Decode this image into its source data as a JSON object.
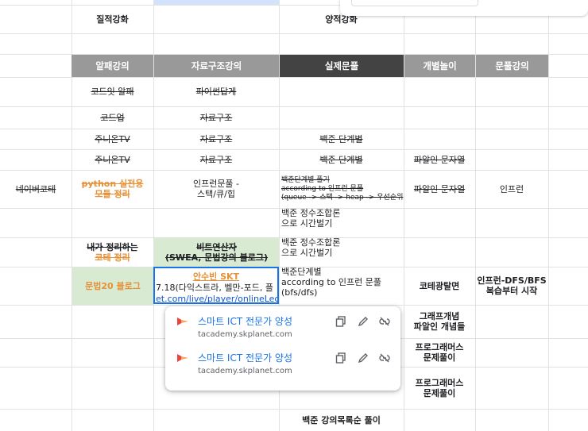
{
  "row_top": {
    "col1": "질적강화",
    "col3": "양적강화"
  },
  "headers": {
    "c1": "알패강의",
    "c2": "자료구조강의",
    "c3": "실제문풀",
    "c4": "개별놀이",
    "c5": "문풀강의"
  },
  "rows": {
    "r1_c1": "코드잇 알패",
    "r1_c2": "파이썬답게",
    "r2_c1": "코드업",
    "r2_c2": "자료구조",
    "r3_c1": "주니온TV",
    "r3_c2": "자료구조",
    "r3_c3": "백준 단계별",
    "r4_c1": "주니온TV",
    "r4_c2": "자료구조",
    "r4_c3": "백준 단계별",
    "r4_c4": "파알인 문자열",
    "r5_c0": "네이버코테",
    "r5_c1_l1": "python 실전용",
    "r5_c1_l2": "모듈 정리",
    "r5_c2_l1": "인프런문풀 -",
    "r5_c2_l2": "스택/큐/힙",
    "r5_c3_l1": "백준단계별 풀기",
    "r5_c3_l2": "according to 인프런 문풀",
    "r5_c3_l3": "(queue -> 스택 -> heap -> 우선순위",
    "r5_c4": "파알인 문자열",
    "r5_c5": "인프런",
    "r6_c3_l1": "백준 정수조합론",
    "r6_c3_l2": "으로 시간벌기",
    "r7_c1_l1": "내가 정리하는",
    "r7_c1_l2": "코테 정리",
    "r7_c2_l1": "비트연산자",
    "r7_c2_l2": "(SWEA, 문법강의 블로그)",
    "r7_c3_l1": "백준 정수조합론",
    "r7_c3_l2": "으로 시간벌기",
    "r8_c1": "문법20 블로그",
    "r8_c2_l1": "안수빈 SKT",
    "r8_c2_l2": "7.18(다익스트라, 벨만-포드, 플",
    "r8_c2_l3": "et.com/live/player/onlineLectu",
    "r8_c3_l1": "백준단계별",
    "r8_c3_l2": "according to 인프런 문풀",
    "r8_c3_l3": "(bfs/dfs)",
    "r8_c4": "코테광탈면",
    "r8_c5_l1": "인프런-DFS/BFS",
    "r8_c5_l2": "복습부터 시작",
    "r9_c4_l1": "그래프개념",
    "r9_c4_l2": "파알인 개념들",
    "r10_c4_l1": "프로그래머스",
    "r10_c4_l2": "문제풀이",
    "r11_c4_l1": "프로그래머스",
    "r11_c4_l2": "문제풀이",
    "r12_c3": "백준 강의목록순 풀이"
  },
  "link_popup": {
    "items": [
      {
        "title": "스마트 ICT 전문가 양성",
        "url": "tacademy.skplanet.com"
      },
      {
        "title": "스마트 ICT 전문가 양성",
        "url": "tacademy.skplanet.com"
      }
    ],
    "icons": [
      "copy-icon",
      "edit-icon",
      "unlink-icon"
    ]
  },
  "colors": {
    "header_gray": "#999999",
    "header_dark": "#434343",
    "green_fill": "#d9ead3",
    "orange_text": "#e69138",
    "link_blue": "#1a73e8",
    "logo_red": "#e8453c"
  }
}
